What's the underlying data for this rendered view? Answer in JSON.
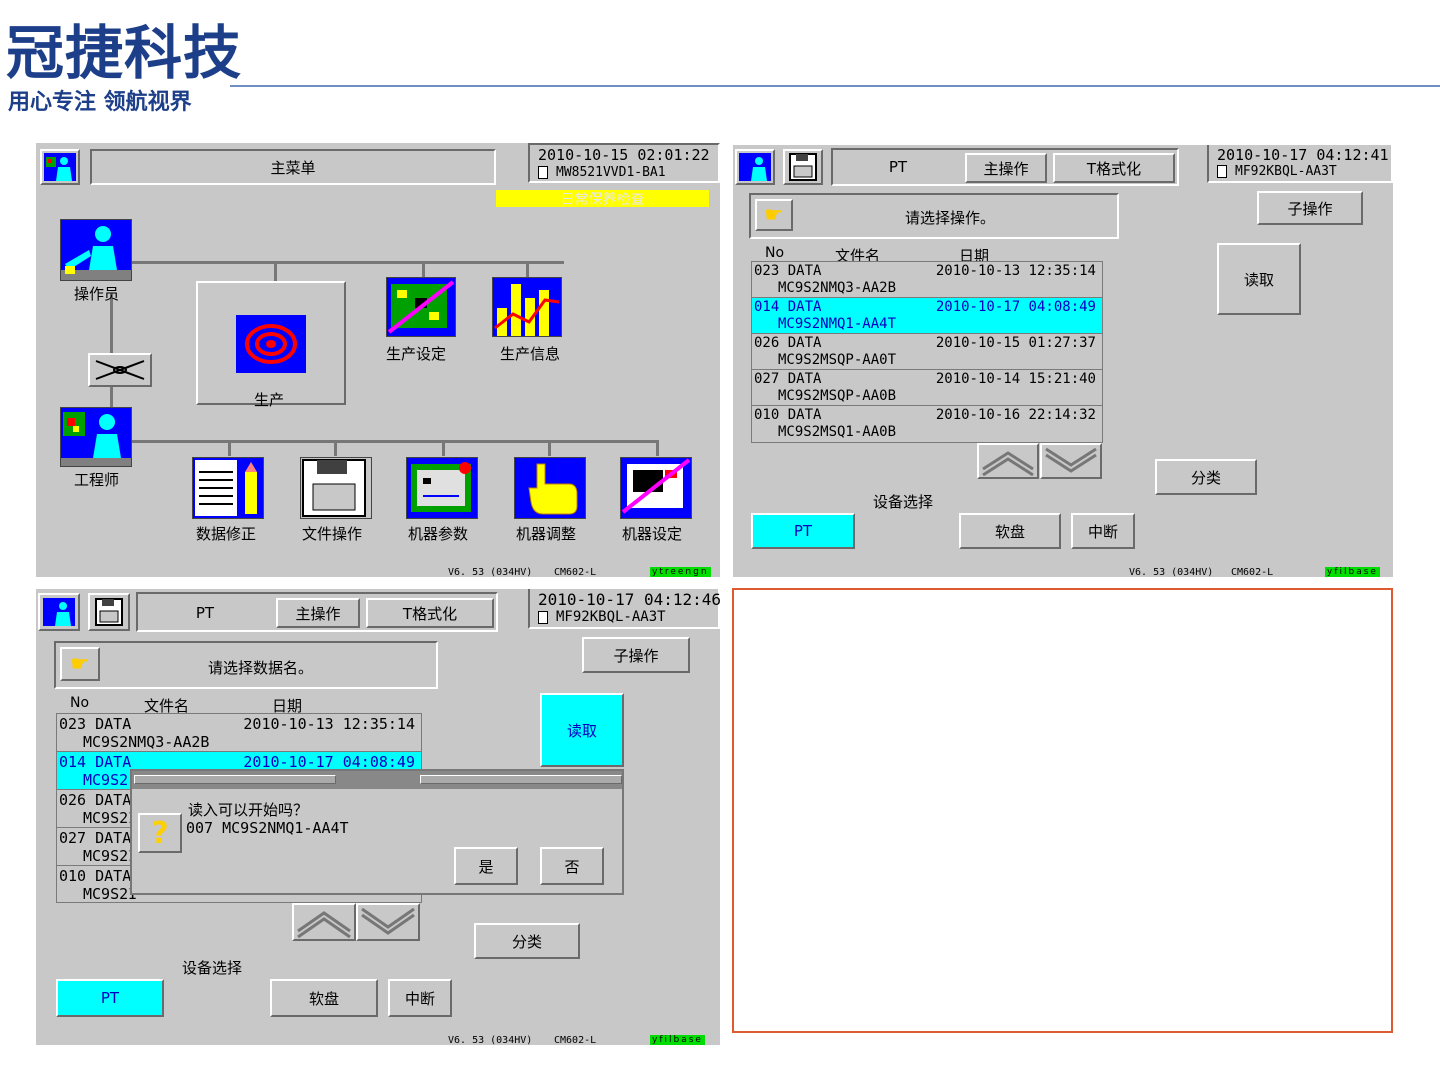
{
  "brand": {
    "title": "冠捷科技",
    "subtitle": "用心专注 领航视界"
  },
  "p1": {
    "title": "主菜单",
    "datetime": "2010-10-15  02:01:22",
    "file": "MW8521VVD1-BA1",
    "notice": "日常保养检查",
    "operator": "操作员",
    "engineer": "工程师",
    "production": "生产",
    "prod_setting": "生产设定",
    "prod_info": "生产信息",
    "data_fix": "数据修正",
    "file_op": "文件操作",
    "machine_param": "机器参数",
    "machine_adjust": "机器调整",
    "machine_setting": "机器设定",
    "version": "V6. 53 (034HV)",
    "model": "CM602-L",
    "tag": "ytreengn"
  },
  "p2": {
    "pt": "PT",
    "main_op": "主操作",
    "format": "T格式化",
    "datetime": "2010-10-17  04:12:41",
    "file": "MF92KBQL-AA3T",
    "prompt": "请选择操作。",
    "sub_op": "子操作",
    "read": "读取",
    "col_no": "No",
    "col_file": "文件名",
    "col_date": "日期",
    "rows": [
      {
        "no": "023",
        "type": "DATA",
        "name": "MC9S2NMQ3-AA2B",
        "date": "2010-10-13 12:35:14"
      },
      {
        "no": "014",
        "type": "DATA",
        "name": "MC9S2NMQ1-AA4T",
        "date": "2010-10-17 04:08:49"
      },
      {
        "no": "026",
        "type": "DATA",
        "name": "MC9S2MSQP-AA0T",
        "date": "2010-10-15 01:27:37"
      },
      {
        "no": "027",
        "type": "DATA",
        "name": "MC9S2MSQP-AA0B",
        "date": "2010-10-14 15:21:40"
      },
      {
        "no": "010",
        "type": "DATA",
        "name": "MC9S2MSQ1-AA0B",
        "date": "2010-10-16 22:14:32"
      }
    ],
    "classify": "分类",
    "device_select": "设备选择",
    "dev_pt": "PT",
    "dev_floppy": "软盘",
    "dev_abort": "中断",
    "version": "V6. 53 (034HV)",
    "model": "CM602-L",
    "tag": "yfilbase"
  },
  "p3": {
    "pt": "PT",
    "main_op": "主操作",
    "format": "T格式化",
    "datetime": "2010-10-17  04:12:46",
    "file": "MF92KBQL-AA3T",
    "prompt": "请选择数据名。",
    "sub_op": "子操作",
    "read": "读取",
    "col_no": "No",
    "col_file": "文件名",
    "col_date": "日期",
    "rows": [
      {
        "no": "023",
        "type": "DATA",
        "name": "MC9S2NMQ3-AA2B",
        "date": "2010-10-13 12:35:14"
      },
      {
        "no": "014",
        "type": "DATA",
        "name": "MC9S2",
        "date": "2010-10-17 04:08:49"
      },
      {
        "no": "026",
        "type": "DATA",
        "name": "MC9S2I",
        "date": ""
      },
      {
        "no": "027",
        "type": "DATA",
        "name": "MC9S2I",
        "date": ""
      },
      {
        "no": "010",
        "type": "DATA",
        "name": "MC9S2I",
        "date": ""
      }
    ],
    "dialog_q": "读入可以开始吗？",
    "dialog_file": "007   MC9S2NMQ1-AA4T",
    "yes": "是",
    "no": "否",
    "classify": "分类",
    "device_select": "设备选择",
    "dev_pt": "PT",
    "dev_floppy": "软盘",
    "dev_abort": "中断",
    "version": "V6. 53 (034HV)",
    "model": "CM602-L",
    "tag": "yfilbase"
  },
  "colors": {
    "panel": "#c8c8c8",
    "highlight": "#00ffff",
    "notice": "#ffff00",
    "frame": "#e05a30",
    "brand": "#1d3f8a"
  }
}
